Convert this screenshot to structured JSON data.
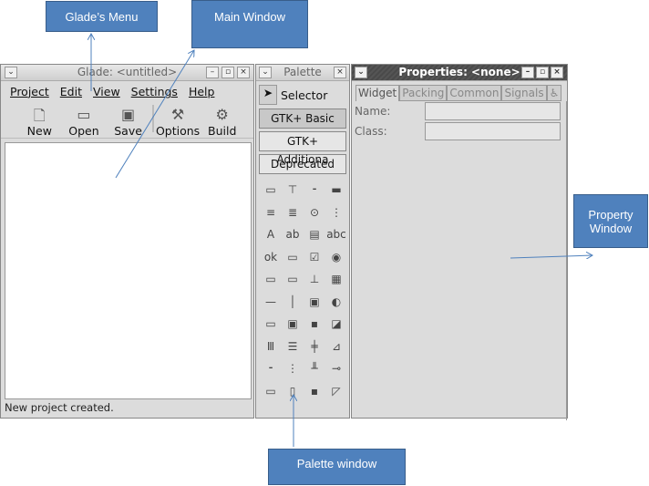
{
  "callouts": {
    "menu": "Glade’s Menu",
    "main": "Main Window",
    "property": "Property Window",
    "palette": "Palette window"
  },
  "main": {
    "title": "Glade: <untitled>",
    "menu": [
      "Project",
      "Edit",
      "View",
      "Settings",
      "Help"
    ],
    "toolbar": [
      {
        "label": "New",
        "icon": "new-icon"
      },
      {
        "label": "Open",
        "icon": "folder-icon"
      },
      {
        "label": "Save",
        "icon": "save-icon"
      },
      {
        "label": "Options",
        "icon": "wrench-icon"
      },
      {
        "label": "Build",
        "icon": "build-icon"
      }
    ],
    "status": "New project created."
  },
  "palette": {
    "title": "Palette",
    "selector": "Selector",
    "groups": [
      "GTK+ Basic",
      "GTK+ Additiona",
      "Deprecated"
    ],
    "icons": [
      "▭",
      "⊤",
      "⁃",
      "▬",
      "≡",
      "≣",
      "⊙",
      "⋮",
      "A",
      "ab",
      "▤",
      "abc",
      "ok",
      "▭",
      "☑",
      "◉",
      "▭",
      "▭",
      "⊥",
      "▦",
      "—",
      "│",
      "▣",
      "◐",
      "▭",
      "▣",
      "▪",
      "◪",
      "Ⅲ",
      "☰",
      "╪",
      "⊿",
      "⁃",
      "⋮",
      "╨",
      "⊸",
      "▭",
      "▯",
      "▪",
      "◸"
    ]
  },
  "properties": {
    "title": "Properties: <none>",
    "tabs": [
      "Widget",
      "Packing",
      "Common",
      "Signals",
      "♿"
    ],
    "fields": [
      "Name:",
      "Class:"
    ]
  }
}
